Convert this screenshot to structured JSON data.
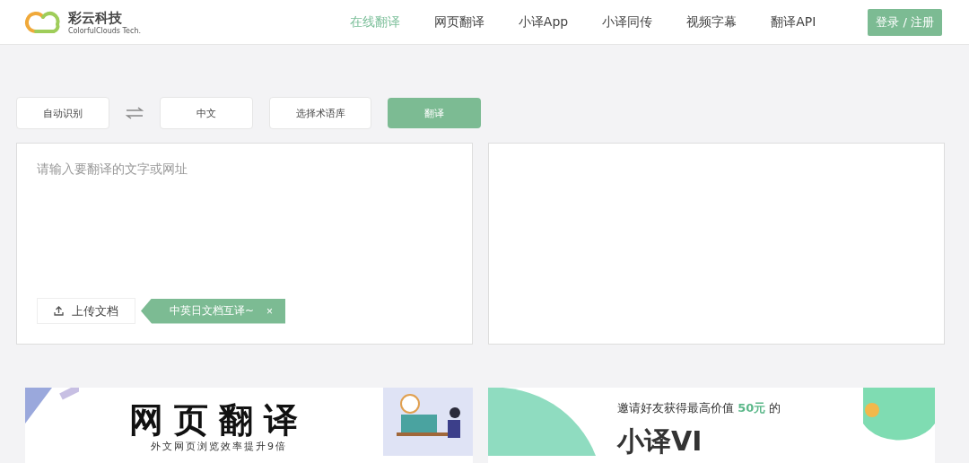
{
  "logo": {
    "name": "彩云科技",
    "tagline": "ColorfulClouds Tech."
  },
  "nav": [
    {
      "label": "在线翻译",
      "selected": true
    },
    {
      "label": "网页翻译",
      "selected": false
    },
    {
      "label": "小译App",
      "selected": false
    },
    {
      "label": "小译同传",
      "selected": false
    },
    {
      "label": "视频字幕",
      "selected": false
    },
    {
      "label": "翻译API",
      "selected": false
    }
  ],
  "login_button": "登录 / 注册",
  "toolbar": {
    "source_language": "自动识别",
    "target_language": "中文",
    "glossary": "选择术语库",
    "translate_button": "翻译"
  },
  "input": {
    "placeholder": "请输入要翻译的文字或网址"
  },
  "upload_button": "上传文档",
  "upload_tip": {
    "text": "中英日文档互译~",
    "close": "×"
  },
  "banners": [
    {
      "title": "网页翻译",
      "subtitle": "外文网页浏览效率提升9倍"
    },
    {
      "line_before": "邀请好友获得最高价值",
      "highlight": "50元",
      "line_after": "的",
      "title": "小译VI"
    }
  ]
}
